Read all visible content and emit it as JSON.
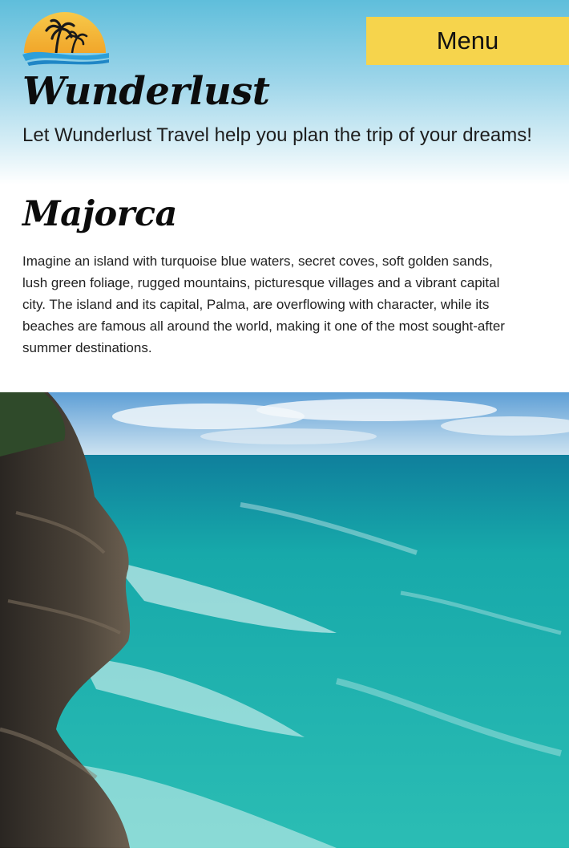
{
  "header": {
    "logo_icon": "palm-sunset-logo-icon",
    "menu_label": "Menu",
    "title": "Wunderlust",
    "tagline": "Let Wunderlust Travel help you plan the trip of your dreams!"
  },
  "destination": {
    "title": "Majorca",
    "description": "Imagine an island with turquoise blue waters, secret coves, soft golden sands, lush green foliage, rugged mountains, picturesque villages and a vibrant capital city. The island and its capital, Palma, are overflowing with character, while its beaches are famous all around the world, making it one of the most sought-after summer destinations.",
    "image_icon": "coastal-cliff-sea-photo"
  },
  "colors": {
    "sky_top": "#5fbedb",
    "menu_button": "#f6d44c",
    "logo_sun": "#f4b731",
    "logo_wave": "#2d9fd9",
    "sea": "#17a9aa"
  }
}
